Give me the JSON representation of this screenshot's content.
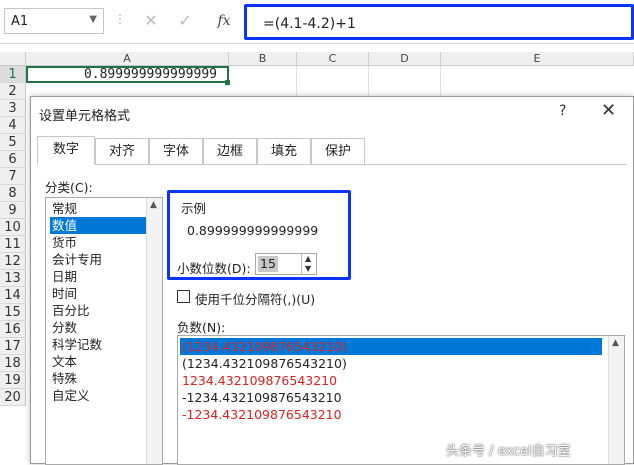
{
  "formula_bar": {
    "name_box": "A1",
    "cancel_symbol": "✕",
    "enter_symbol": "✓",
    "fx_label": "fx",
    "formula": "=(4.1-4.2)+1"
  },
  "sheet": {
    "columns": [
      "A",
      "B",
      "C",
      "D",
      "E"
    ],
    "rows": [
      "1",
      "2",
      "3",
      "4",
      "5",
      "6",
      "7",
      "8",
      "9",
      "10",
      "11",
      "12",
      "13",
      "14",
      "15",
      "16",
      "17",
      "18",
      "19",
      "20"
    ],
    "selected_row": "1",
    "a1_value": "0.899999999999999"
  },
  "dialog": {
    "title": "设置单元格格式",
    "help": "?",
    "close": "✕",
    "tabs": [
      "数字",
      "对齐",
      "字体",
      "边框",
      "填充",
      "保护"
    ],
    "active_tab": 0,
    "category_label": "分类(C):",
    "categories": [
      "常规",
      "数值",
      "货币",
      "会计专用",
      "日期",
      "时间",
      "百分比",
      "分数",
      "科学记数",
      "文本",
      "特殊",
      "自定义"
    ],
    "selected_category": 1,
    "sample_label": "示例",
    "sample_value": "0.899999999999999",
    "decimal_label": "小数位数(D):",
    "decimal_value": "15",
    "thousands_label": "使用千位分隔符(,)(U)",
    "thousands_checked": false,
    "negative_label": "负数(N):",
    "negative_formats": [
      {
        "text": "(1234.432109876543210)",
        "color": "#e02020",
        "selected": true
      },
      {
        "text": "(1234.432109876543210)",
        "color": "#222222",
        "selected": false
      },
      {
        "text": "1234.432109876543210",
        "color": "#e02020",
        "selected": false
      },
      {
        "text": "-1234.432109876543210",
        "color": "#222222",
        "selected": false
      },
      {
        "text": "-1234.432109876543210",
        "color": "#e02020",
        "selected": false
      }
    ]
  },
  "watermark": "头条号 / excel自习室",
  "colors": {
    "highlight": "#0a33ff",
    "excel_green": "#217346",
    "selection_blue": "#0078d7",
    "negative_red": "#e02020"
  }
}
